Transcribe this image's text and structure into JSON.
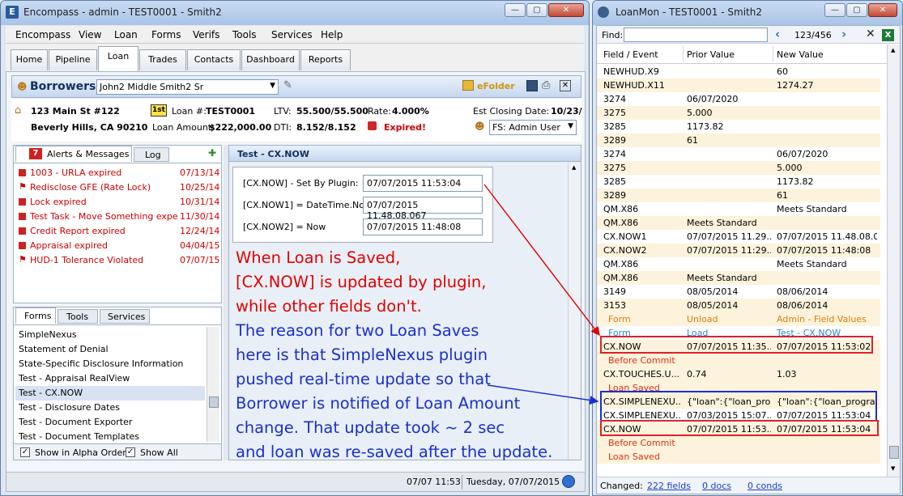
{
  "main_window": {
    "title": "Encompass - admin - TEST0001 - Smith2",
    "controls": [
      "—",
      "▢",
      "✕"
    ]
  },
  "menu": [
    "Encompass",
    "View",
    "Loan",
    "Forms",
    "Verifs",
    "Tools",
    "Services",
    "Help"
  ],
  "tabs": [
    "Home",
    "Pipeline",
    "Loan",
    "Trades",
    "Contacts",
    "Dashboard",
    "Reports"
  ],
  "borrowers": {
    "label": "Borrowers",
    "selected": "John2 Middle Smith2 Sr",
    "efolder": "eFolder"
  },
  "loan_summary": {
    "address1": "123 Main St #122",
    "address2": "Beverly Hills, CA 90210",
    "lien_badge": "1st",
    "loan_num_label": "Loan #:",
    "loan_num": "TEST0001",
    "amount_label": "Loan Amount:",
    "amount": "$222,000.00",
    "ltv_label": "LTV:",
    "ltv": "55.500/55.500",
    "dti_label": "DTI:",
    "dti": "8.152/8.152",
    "rate_label": "Rate:",
    "rate": "4.000%",
    "expired": "Expired!",
    "closing_label": "Est Closing Date:",
    "closing": "10/23/",
    "fs_user": "FS: Admin User"
  },
  "alerts": {
    "tab_alerts": "Alerts & Messages",
    "badge": "7",
    "tab_log": "Log",
    "items": [
      {
        "text": "1003 - URLA expired",
        "date": "07/13/14"
      },
      {
        "text": "Redisclose GFE (Rate Lock)",
        "date": "10/25/14"
      },
      {
        "text": "Lock expired",
        "date": "10/31/14"
      },
      {
        "text": "Test Task - Move Something expe",
        "date": "11/30/14"
      },
      {
        "text": "Credit Report expired",
        "date": "12/24/14"
      },
      {
        "text": "Appraisal expired",
        "date": "04/04/15"
      },
      {
        "text": "HUD-1 Tolerance Violated",
        "date": "07/07/15"
      }
    ]
  },
  "forms_panel": {
    "tabs": [
      "Forms",
      "Tools",
      "Services"
    ],
    "items": [
      "SimpleNexus",
      "Statement of Denial",
      "State-Specific Disclosure Information",
      "Test - Appraisal RealView",
      "Test - CX.NOW",
      "Test - Disclosure Dates",
      "Test - Document Exporter",
      "Test - Document Templates"
    ],
    "selected_index": 4,
    "show_alpha": "Show in Alpha Order",
    "show_all": "Show All"
  },
  "form": {
    "title": "Test - CX.NOW",
    "fields": [
      {
        "label": "[CX.NOW] - Set By Plugin:",
        "value": "07/07/2015 11:53:04"
      },
      {
        "label": "[CX.NOW1] = DateTime.Now",
        "value": "07/07/2015 11.48.08.067"
      },
      {
        "label": "[CX.NOW2] = Now",
        "value": "07/07/2015 11:48:08"
      }
    ]
  },
  "annotation": {
    "red_lines": [
      "When Loan is Saved,",
      "[CX.NOW] is updated by plugin,",
      "while other fields don't."
    ],
    "blue_lines": [
      "The reason for two Loan Saves",
      "here is that SimpleNexus plugin",
      "pushed real-time update so that",
      "Borrower is notified of Loan Amount",
      "change.  That update took ~ 2 sec",
      "and loan was re-saved after the update."
    ]
  },
  "status_bar": {
    "time": "07/07 11:53",
    "date": "Tuesday, 07/07/2015"
  },
  "loanmon": {
    "title": "LoanMon - TEST0001 - Smith2",
    "find_label": "Find:",
    "find_value": "",
    "counter": "123/456",
    "columns": [
      "Field / Event",
      "Prior Value",
      "New Value"
    ],
    "rows": [
      {
        "f": "NEWHUD.X9",
        "p": "",
        "n": "60",
        "kind": "w"
      },
      {
        "f": "NEWHUD.X11",
        "p": "",
        "n": "1274.27",
        "kind": "y"
      },
      {
        "f": "3274",
        "p": "06/07/2020",
        "n": "",
        "kind": "w"
      },
      {
        "f": "3275",
        "p": "5.000",
        "n": "",
        "kind": "y"
      },
      {
        "f": "3285",
        "p": "1173.82",
        "n": "",
        "kind": "w"
      },
      {
        "f": "3289",
        "p": "61",
        "n": "",
        "kind": "y"
      },
      {
        "f": "3274",
        "p": "",
        "n": "06/07/2020",
        "kind": "w"
      },
      {
        "f": "3275",
        "p": "",
        "n": "5.000",
        "kind": "y"
      },
      {
        "f": "3285",
        "p": "",
        "n": "1173.82",
        "kind": "w"
      },
      {
        "f": "3289",
        "p": "",
        "n": "61",
        "kind": "y"
      },
      {
        "f": "QM.X86",
        "p": "",
        "n": "Meets Standard",
        "kind": "w"
      },
      {
        "f": "QM.X86",
        "p": "Meets Standard",
        "n": "",
        "kind": "y"
      },
      {
        "f": "CX.NOW1",
        "p": "07/07/2015 11.29...",
        "n": "07/07/2015 11.48.08.0...",
        "kind": "w"
      },
      {
        "f": "CX.NOW2",
        "p": "07/07/2015 11:29...",
        "n": "07/07/2015 11:48:08",
        "kind": "y"
      },
      {
        "f": "QM.X86",
        "p": "",
        "n": "Meets Standard",
        "kind": "w"
      },
      {
        "f": "QM.X86",
        "p": "Meets Standard",
        "n": "",
        "kind": "y"
      },
      {
        "f": "3149",
        "p": "08/05/2014",
        "n": "08/06/2014",
        "kind": "w"
      },
      {
        "f": "3153",
        "p": "08/05/2014",
        "n": "08/06/2014",
        "kind": "y"
      },
      {
        "f": "Form",
        "p": "Unload",
        "n": "Admin - Field Values",
        "kind": "ev-o"
      },
      {
        "f": "Form",
        "p": "Load",
        "n": "Test - CX.NOW",
        "kind": "ev-b"
      },
      {
        "f": "CX.NOW",
        "p": "07/07/2015 11:35...",
        "n": "07/07/2015 11:53:02",
        "kind": "y"
      },
      {
        "f": "Before Commit",
        "p": "",
        "n": "",
        "kind": "ev-r"
      },
      {
        "f": "CX.TOUCHES.U...",
        "p": "0.74",
        "n": "1.03",
        "kind": "y"
      },
      {
        "f": "Loan Saved",
        "p": "",
        "n": "",
        "kind": "ev-r"
      },
      {
        "f": "CX.SIMPLENEXU...",
        "p": "{\"loan\":{\"loan_pro...",
        "n": "{\"loan\":{\"loan_program...",
        "kind": "y"
      },
      {
        "f": "CX.SIMPLENEXU...",
        "p": "07/03/2015 15:07...",
        "n": "07/07/2015 11:53:04",
        "kind": "w"
      },
      {
        "f": "CX.NOW",
        "p": "07/07/2015 11:53...",
        "n": "07/07/2015 11:53:04",
        "kind": "y"
      },
      {
        "f": "Before Commit",
        "p": "",
        "n": "",
        "kind": "ev-r"
      },
      {
        "f": "Loan Saved",
        "p": "",
        "n": "",
        "kind": "ev-r"
      }
    ],
    "changed_label": "Changed:",
    "changed_fields": "222 fields",
    "changed_docs": "0 docs",
    "changed_conds": "0 conds"
  },
  "colors": {
    "title_bar": "#a9c4e6",
    "alert_red": "#cc0000",
    "annotation_red": "#e00000",
    "annotation_blue": "#1a2fd0",
    "row_yellow": "#fdf3dc"
  }
}
